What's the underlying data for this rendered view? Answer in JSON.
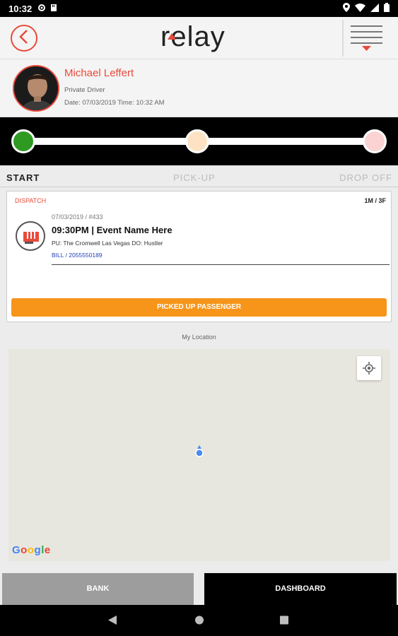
{
  "status_bar": {
    "time": "10:32",
    "icons": [
      "settings-icon",
      "storage-icon",
      "location-icon",
      "wifi-icon",
      "signal-icon",
      "battery-icon"
    ]
  },
  "app_bar": {
    "logo_text": "relay",
    "icons": [
      "back-icon",
      "menu-icon"
    ],
    "accent_color": "#e84a3b"
  },
  "profile": {
    "name": "Michael Leffert",
    "role": "Private Driver",
    "datetime": "Date: 07/03/2019 Time: 10:32 AM"
  },
  "progress": {
    "steps": [
      {
        "label": "START",
        "state": "complete",
        "color": "#2e9a22"
      },
      {
        "label": "PICK-UP",
        "state": "pending",
        "color": "#fde3c4"
      },
      {
        "label": "DROP OFF",
        "state": "pending",
        "color": "#fbd3d3"
      }
    ]
  },
  "trip_card": {
    "status": "DISPATCH",
    "rooms": "1M / 3F",
    "date_id": "07/03/2019 / #433",
    "event": "09:30PM | Event Name Here",
    "pickup": "PU: The Cromwell Las Vegas DO: Hustler",
    "contact": "BILL  /  2055550189",
    "action_label": "PICKED UP PASSENGER",
    "action_color": "#f6951a"
  },
  "map": {
    "label": "My Location",
    "attribution": "Google",
    "icons": [
      "my-location-icon",
      "current-location-pin-icon"
    ]
  },
  "bottom_tabs": {
    "bank": "BANK",
    "dashboard": "DASHBOARD"
  },
  "nav_bar": {
    "icons": [
      "back-triangle-icon",
      "home-circle-icon",
      "recents-square-icon"
    ]
  }
}
